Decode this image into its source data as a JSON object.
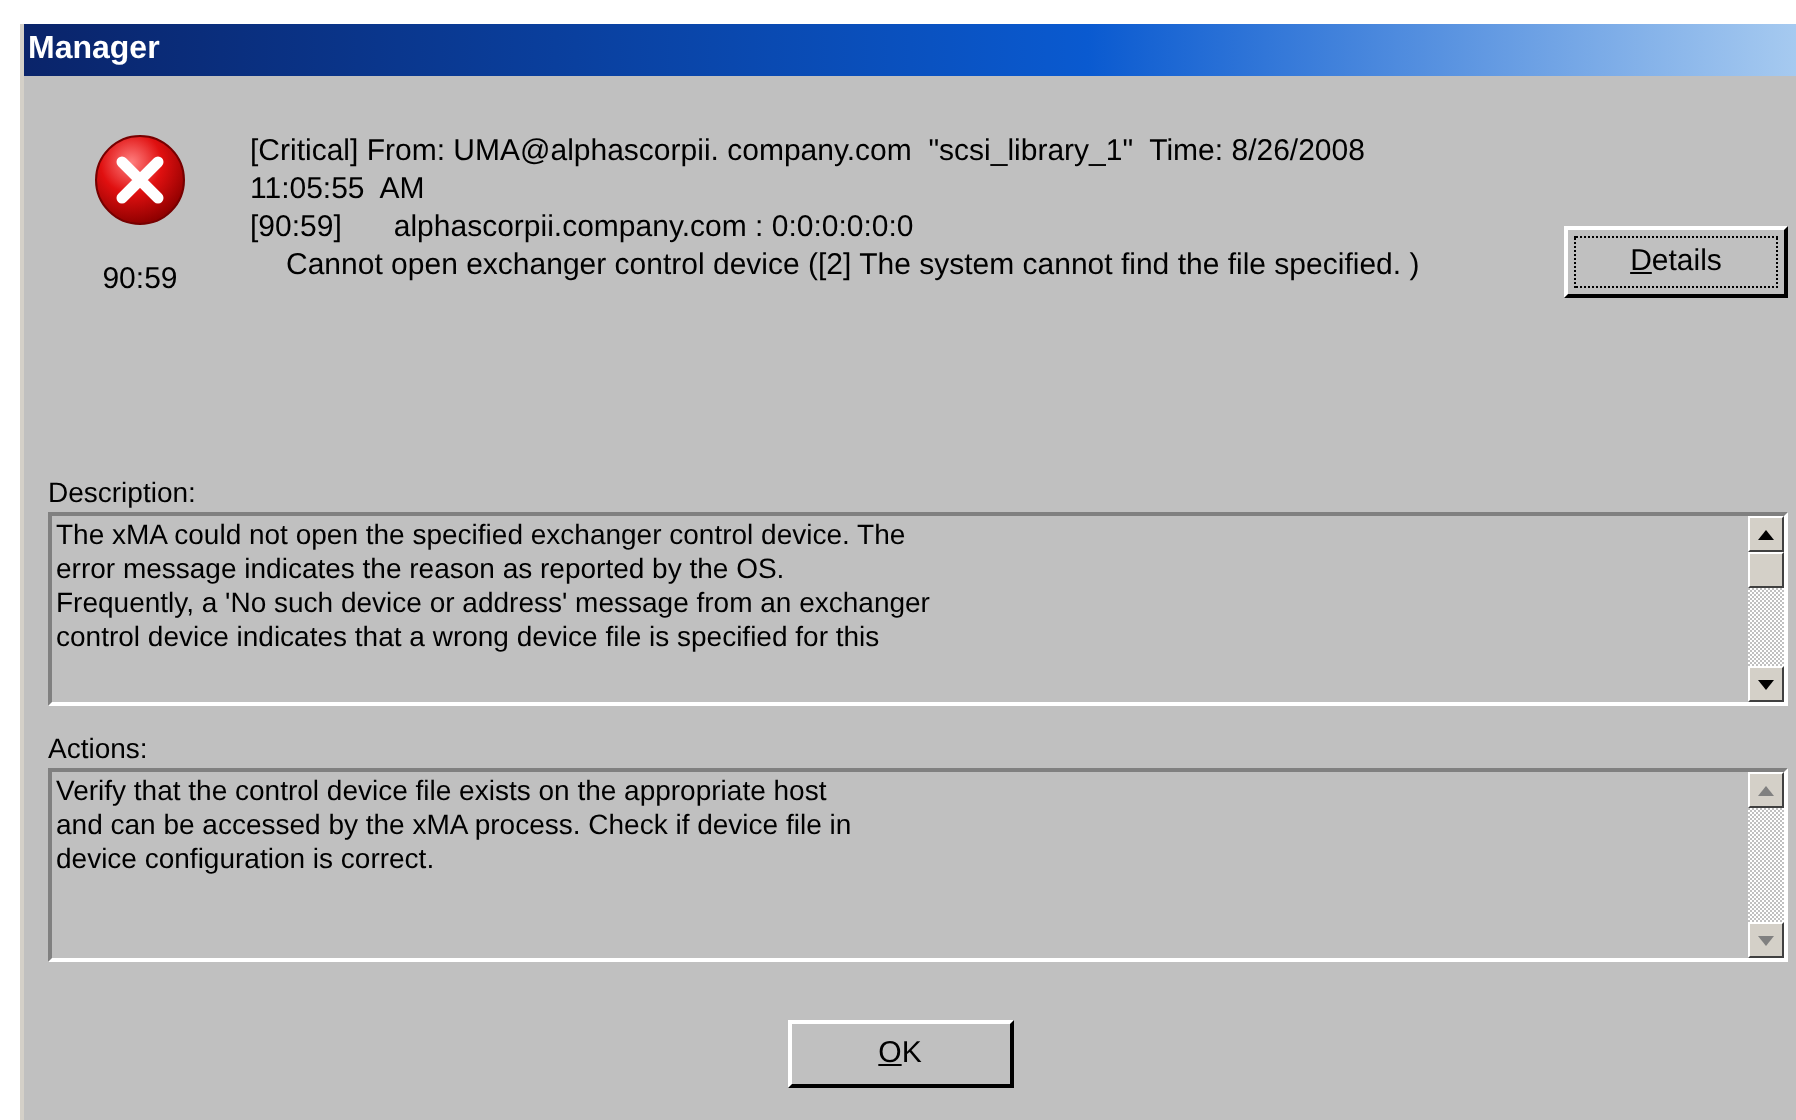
{
  "window": {
    "title": "Manager"
  },
  "alert": {
    "code": "90:59",
    "header": "[Critical] From: UMA@alphascorpii. company.com  \"scsi_library_1\"  Time: 8/26/2008",
    "time": "11:05:55  AM",
    "source_id": "[90:59]",
    "source": "alphascorpii.company.com : 0:0:0:0:0:0",
    "message": "Cannot open exchanger control device ([2] The system cannot find the file specified. )"
  },
  "details_button": "Details",
  "description": {
    "label": "Description:",
    "scrollable": true,
    "lines": [
      "The xMA could not open the specified exchanger control device. The",
      "error message indicates the reason as reported by the OS.",
      "Frequently, a 'No such device or address' message from an exchanger",
      "control device indicates that a wrong device file is specified for this"
    ]
  },
  "actions": {
    "label": "Actions:",
    "scrollable": false,
    "lines": [
      "Verify that the control device file exists on the appropriate host",
      "and can be accessed by the xMA process. Check if device file in",
      "device configuration is correct."
    ]
  },
  "ok_button": "OK"
}
